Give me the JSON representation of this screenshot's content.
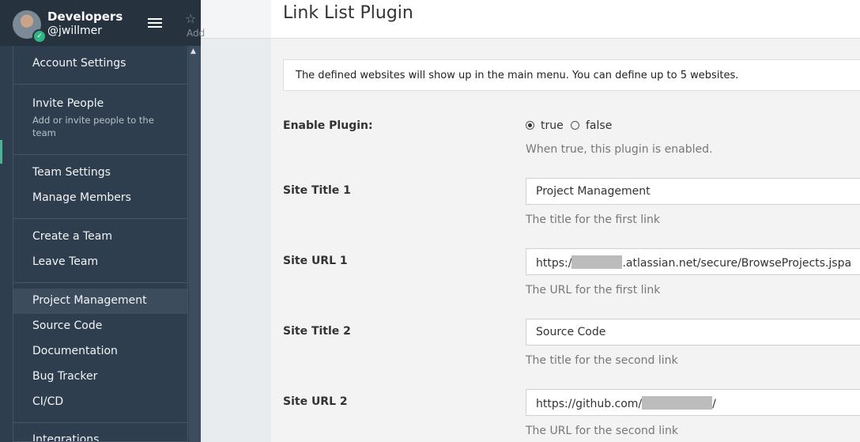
{
  "sidebar": {
    "team_name": "Developers",
    "user_name": "@jwillmer",
    "header_fragment": "Add"
  },
  "menu": {
    "account_settings": "Account Settings",
    "invite_people": "Invite People",
    "invite_people_desc": "Add or invite people to the team",
    "team_settings": "Team Settings",
    "manage_members": "Manage Members",
    "create_team": "Create a Team",
    "leave_team": "Leave Team",
    "links": [
      "Project Management",
      "Source Code",
      "Documentation",
      "Bug Tracker",
      "CI/CD"
    ],
    "integrations": "Integrations"
  },
  "plugin": {
    "title": "Link List Plugin",
    "banner": "The defined websites will show up in the main menu. You can define up to 5 websites.",
    "enable_label": "Enable Plugin:",
    "opt_true": "true",
    "opt_false": "false",
    "enable_selected": "true",
    "enable_help": "When true, this plugin is enabled.",
    "site_title_1_label": "Site Title 1",
    "site_title_1_value": "Project Management",
    "site_title_1_help": "The title for the first link",
    "site_url_1_label": "Site URL 1",
    "site_url_1_prefix": "https:/",
    "site_url_1_suffix": ".atlassian.net/secure/BrowseProjects.jspa",
    "site_url_1_help": "The URL for the first link",
    "site_title_2_label": "Site Title 2",
    "site_title_2_value": "Source Code",
    "site_title_2_help": "The title for the second link",
    "site_url_2_label": "Site URL 2",
    "site_url_2_prefix": "https://github.com/",
    "site_url_2_suffix": "/",
    "site_url_2_help": "The URL for the second link"
  },
  "colors": {
    "sidebar_bg": "#2f3e4e",
    "status_online": "#2fb683",
    "panel_bg": "#f3f3f3"
  }
}
